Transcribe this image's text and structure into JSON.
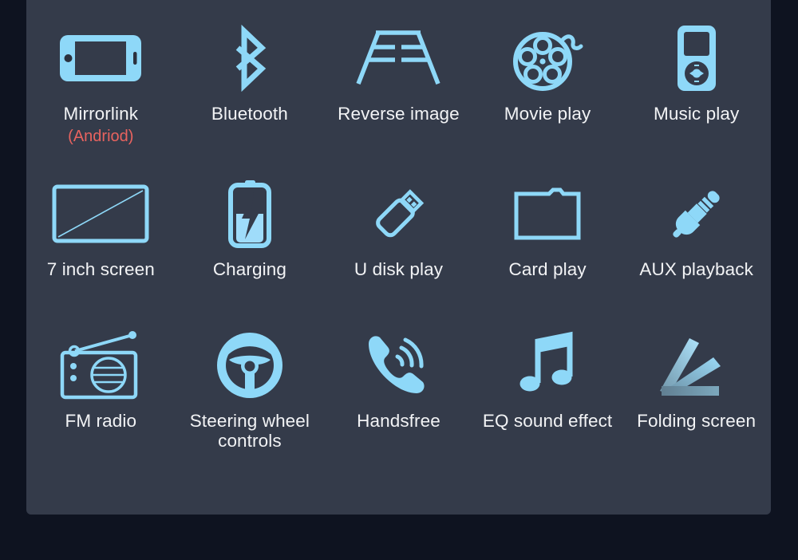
{
  "theme": {
    "outer_background": "#0e1320",
    "panel_background": "#343b4a",
    "icon_color": "#8ed8f8",
    "label_color": "#f2f3f5",
    "sublabel_color": "#e8635f",
    "folding_accent_color": "#5d7f93"
  },
  "features": [
    [
      {
        "label": "Mirrorlink",
        "sublabel": "(Andriod)",
        "icon": "smartphone-icon"
      },
      {
        "label": "Bluetooth",
        "sublabel": "",
        "icon": "bluetooth-icon"
      },
      {
        "label": "Reverse image",
        "sublabel": "",
        "icon": "parking-guidelines-icon"
      },
      {
        "label": "Movie play",
        "sublabel": "",
        "icon": "film-reel-icon"
      },
      {
        "label": "Music play",
        "sublabel": "",
        "icon": "mp3-player-icon"
      }
    ],
    [
      {
        "label": "7 inch screen",
        "sublabel": "",
        "icon": "screen-diagonal-icon"
      },
      {
        "label": "Charging",
        "sublabel": "",
        "icon": "battery-charging-icon"
      },
      {
        "label": "U disk play",
        "sublabel": "",
        "icon": "usb-flash-drive-icon"
      },
      {
        "label": "Card play",
        "sublabel": "",
        "icon": "sd-card-icon"
      },
      {
        "label": "AUX playback",
        "sublabel": "",
        "icon": "audio-jack-icon"
      }
    ],
    [
      {
        "label": "FM radio",
        "sublabel": "",
        "icon": "radio-icon"
      },
      {
        "label": "Steering wheel controls",
        "sublabel": "",
        "icon": "steering-wheel-icon"
      },
      {
        "label": "Handsfree",
        "sublabel": "",
        "icon": "phone-call-icon"
      },
      {
        "label": "EQ sound effect",
        "sublabel": "",
        "icon": "music-note-icon"
      },
      {
        "label": "Folding screen",
        "sublabel": "",
        "icon": "folding-screen-icon"
      }
    ]
  ]
}
